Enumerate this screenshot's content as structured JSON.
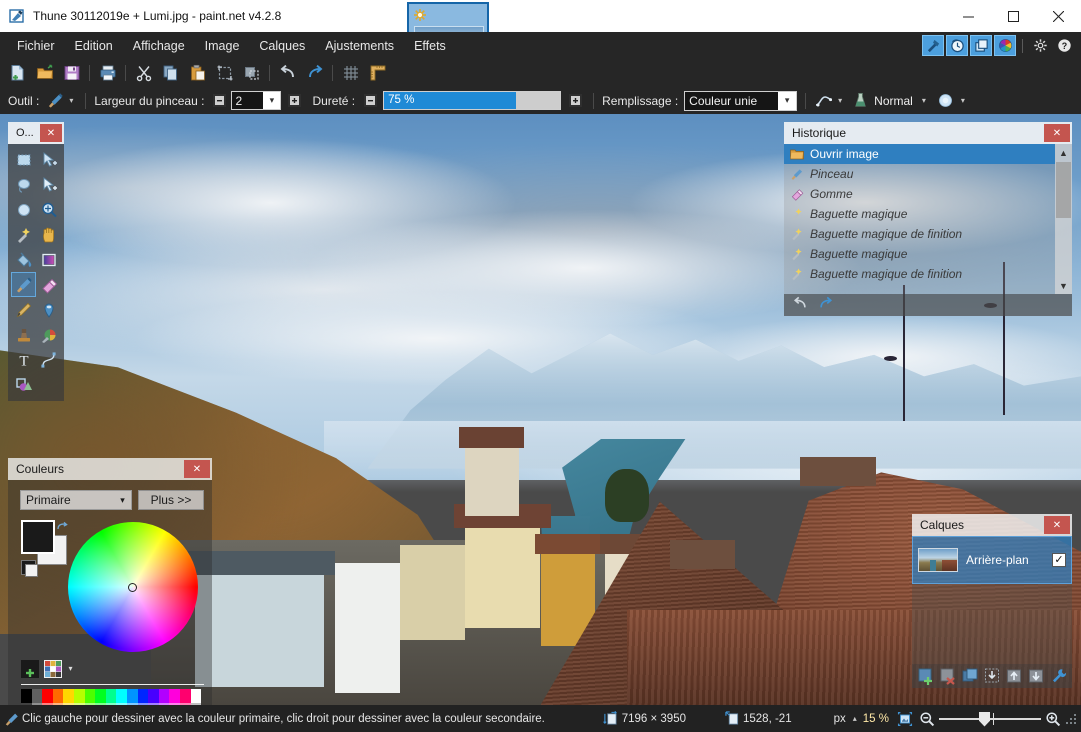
{
  "window": {
    "title": "Thune 30112019e + Lumi.jpg - paint.net v4.2.8",
    "app_icon": "paintnet-icon",
    "minimize": "minimize-icon",
    "maximize": "maximize-icon",
    "close": "close-icon"
  },
  "tab": {
    "dirty_icon": "unsaved-asterisk-icon",
    "thumbnail": "image-thumbnail",
    "overflow_icon": "chevron-down-icon"
  },
  "menubar": {
    "items": [
      {
        "label": "Fichier",
        "name": "menu-fichier"
      },
      {
        "label": "Edition",
        "name": "menu-edition"
      },
      {
        "label": "Affichage",
        "name": "menu-affichage"
      },
      {
        "label": "Image",
        "name": "menu-image"
      },
      {
        "label": "Calques",
        "name": "menu-calques"
      },
      {
        "label": "Ajustements",
        "name": "menu-ajustements"
      },
      {
        "label": "Effets",
        "name": "menu-effets"
      }
    ],
    "panel_toggles": [
      {
        "name": "tools-panel-toggle",
        "icon": "hammer-icon",
        "active": true
      },
      {
        "name": "history-panel-toggle",
        "icon": "clock-icon",
        "active": true
      },
      {
        "name": "layers-panel-toggle",
        "icon": "layers-icon",
        "active": true
      },
      {
        "name": "colors-panel-toggle",
        "icon": "color-wheel-icon",
        "active": true
      }
    ],
    "settings_icon": "gear-icon",
    "help_icon": "help-icon"
  },
  "iconbar": {
    "buttons": [
      {
        "name": "new-button",
        "icon": "new-document-icon"
      },
      {
        "name": "open-button",
        "icon": "open-folder-icon"
      },
      {
        "name": "save-button",
        "icon": "floppy-save-icon"
      },
      {
        "name": "print-button",
        "icon": "printer-icon"
      },
      {
        "name": "cut-button",
        "icon": "scissors-icon"
      },
      {
        "name": "copy-button",
        "icon": "copy-icon"
      },
      {
        "name": "paste-button",
        "icon": "paste-icon"
      },
      {
        "name": "crop-button",
        "icon": "crop-to-selection-icon"
      },
      {
        "name": "deselect-button",
        "icon": "deselect-icon"
      },
      {
        "name": "undo-button",
        "icon": "undo-arrow-icon"
      },
      {
        "name": "redo-button",
        "icon": "redo-arrow-icon"
      },
      {
        "name": "grid-button",
        "icon": "grid-icon"
      },
      {
        "name": "rulers-button",
        "icon": "ruler-icon"
      }
    ]
  },
  "options": {
    "tool_label": "Outil :",
    "tool_icon": "paintbrush-icon",
    "tool_dropdown_icon": "chevron-down-icon",
    "brush_width_label": "Largeur du pinceau :",
    "brush_width_minus": "–",
    "brush_width_value": "2",
    "brush_width_plus": "+",
    "hardness_label": "Dureté :",
    "hardness_minus": "–",
    "hardness_value": "75 %",
    "hardness_percent": 75,
    "hardness_plus": "+",
    "fill_label": "Remplissage :",
    "fill_value": "Couleur unie",
    "antialias_icon": "antialiasing-icon",
    "blend_icon": "blend-mode-icon",
    "blend_value": "Normal",
    "brushtype_icon": "brush-nib-icon",
    "accent_blue": "#1f8ad6"
  },
  "tools_panel": {
    "title": "O...",
    "close_icon": "close-icon",
    "selected_index": 12,
    "tools": [
      {
        "name": "tool-rectangle-select",
        "icon": "rectangle-select-icon"
      },
      {
        "name": "tool-move-selected",
        "icon": "move-selected-icon"
      },
      {
        "name": "tool-lasso-select",
        "icon": "lasso-select-icon"
      },
      {
        "name": "tool-move-selection",
        "icon": "move-selection-icon"
      },
      {
        "name": "tool-ellipse-select",
        "icon": "ellipse-select-icon"
      },
      {
        "name": "tool-zoom",
        "icon": "magnifier-icon"
      },
      {
        "name": "tool-magic-wand",
        "icon": "magic-wand-icon"
      },
      {
        "name": "tool-pan",
        "icon": "hand-pan-icon"
      },
      {
        "name": "tool-paint-bucket",
        "icon": "paint-bucket-icon"
      },
      {
        "name": "tool-gradient",
        "icon": "gradient-icon"
      },
      {
        "name": "tool-paintbrush",
        "icon": "paintbrush-icon"
      },
      {
        "name": "tool-eraser",
        "icon": "eraser-icon"
      },
      {
        "name": "tool-pencil",
        "icon": "pencil-icon"
      },
      {
        "name": "tool-color-picker",
        "icon": "eyedropper-icon"
      },
      {
        "name": "tool-clone-stamp",
        "icon": "clone-stamp-icon"
      },
      {
        "name": "tool-recolor",
        "icon": "recolor-icon"
      },
      {
        "name": "tool-text",
        "icon": "text-T-icon"
      },
      {
        "name": "tool-line-curve",
        "icon": "line-curve-icon"
      },
      {
        "name": "tool-shapes",
        "icon": "shapes-icon"
      }
    ]
  },
  "history_panel": {
    "title": "Historique",
    "close_icon": "close-icon",
    "items": [
      {
        "label": "Ouvrir image",
        "icon": "open-folder-icon",
        "current": true
      },
      {
        "label": "Pinceau",
        "icon": "paintbrush-icon",
        "current": false
      },
      {
        "label": "Gomme",
        "icon": "eraser-icon",
        "current": false
      },
      {
        "label": "Baguette magique",
        "icon": "magic-wand-icon",
        "current": false
      },
      {
        "label": "Baguette magique de finition",
        "icon": "magic-wand-icon",
        "current": false
      },
      {
        "label": "Baguette magique",
        "icon": "magic-wand-icon",
        "current": false
      },
      {
        "label": "Baguette magique de finition",
        "icon": "magic-wand-icon",
        "current": false
      }
    ],
    "scroll_up_icon": "chevron-up-icon",
    "scroll_down_icon": "chevron-down-icon",
    "undo_icon": "undo-arrow-icon",
    "redo_icon": "redo-arrow-icon"
  },
  "colors_panel": {
    "title": "Couleurs",
    "close_icon": "close-icon",
    "mode_value": "Primaire",
    "mode_dropdown_icon": "chevron-down-icon",
    "more_label": "Plus >>",
    "primary_color": "#1a1a1a",
    "secondary_color": "#f2f2f2",
    "swap_icon": "swap-colors-icon",
    "reset_icon": "reset-colors-icon",
    "wheel_icon": "color-wheel",
    "add_swatch_icon": "add-swatch-icon",
    "palette_icon": "palette-icon",
    "palette_dropdown_icon": "chevron-down-icon",
    "palette_colors": [
      [
        "#000000",
        "#404040"
      ],
      [
        "#606060",
        "#909090"
      ],
      [
        "#ff0000",
        "#ff8080"
      ],
      [
        "#ff6a00",
        "#ffb380"
      ],
      [
        "#ffd800",
        "#ffe97f"
      ],
      [
        "#b6ff00",
        "#daff7f"
      ],
      [
        "#4cff00",
        "#a5ff7f"
      ],
      [
        "#00ff21",
        "#7fff8e"
      ],
      [
        "#00ff90",
        "#7fffc6"
      ],
      [
        "#00ffff",
        "#7fffff"
      ],
      [
        "#0094ff",
        "#7fc9ff"
      ],
      [
        "#0026ff",
        "#7f92ff"
      ],
      [
        "#4800ff",
        "#a37fff"
      ],
      [
        "#b200ff",
        "#d67fff"
      ],
      [
        "#ff00dc",
        "#ff7fed"
      ],
      [
        "#ff006e",
        "#ff7fb6"
      ],
      [
        "#ffffff",
        "#c0c0c0"
      ]
    ]
  },
  "layers_panel": {
    "title": "Calques",
    "close_icon": "close-icon",
    "layers": [
      {
        "name": "Arrière-plan",
        "visible": true,
        "check_mark": "✓",
        "thumbnail": "layer-thumbnail"
      }
    ],
    "footer_buttons": [
      {
        "name": "add-layer-button",
        "icon": "add-layer-icon"
      },
      {
        "name": "delete-layer-button",
        "icon": "delete-layer-icon"
      },
      {
        "name": "duplicate-layer-button",
        "icon": "duplicate-layer-icon"
      },
      {
        "name": "merge-layer-down-button",
        "icon": "merge-down-icon"
      },
      {
        "name": "move-layer-up-button",
        "icon": "move-layer-up-icon"
      },
      {
        "name": "move-layer-down-button",
        "icon": "move-layer-down-icon"
      },
      {
        "name": "layer-properties-button",
        "icon": "wrench-icon"
      }
    ]
  },
  "statusbar": {
    "tip_icon": "paintbrush-icon",
    "message": "Clic gauche pour dessiner avec la couleur primaire, clic droit pour dessiner avec la couleur secondaire.",
    "image_size_icon": "image-size-icon",
    "image_size": "7196 × 3950",
    "cursor_pos_icon": "cursor-position-icon",
    "cursor_position": "1528, -21",
    "unit": "px",
    "unit_dropdown_icon": "chevron-up-icon",
    "zoom_value": "15 %",
    "fit_icon": "fit-to-window-icon",
    "zoom_out_icon": "zoom-out-icon",
    "zoom_in_icon": "zoom-in-icon",
    "resize_grip_icon": "resize-grip-icon"
  }
}
